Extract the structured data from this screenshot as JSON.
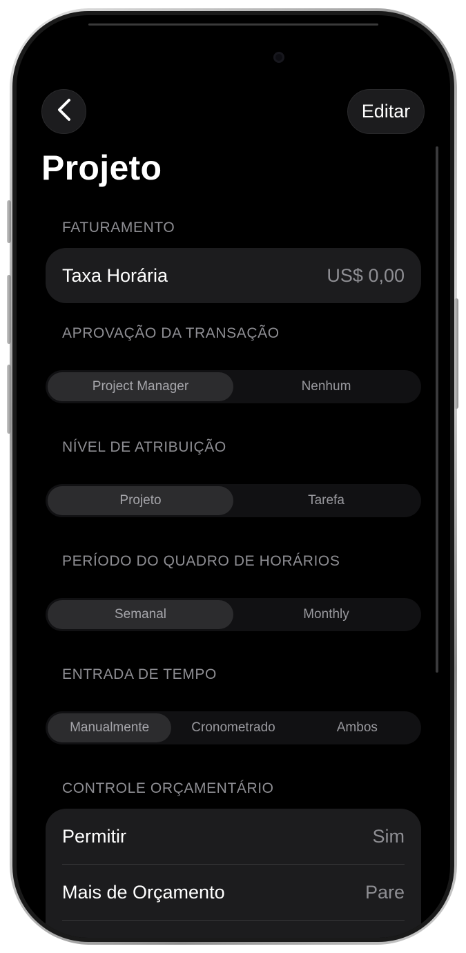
{
  "nav": {
    "back_icon": "chevron-left-icon",
    "edit_label": "Editar"
  },
  "title": "Projeto",
  "sections": {
    "faturamento": {
      "label": "FATURAMENTO",
      "row_label": "Taxa Horária",
      "row_value": "US$ 0,00"
    },
    "aprovacao": {
      "label": "APROVAÇÃO DA TRANSAÇÃO",
      "options": [
        "Project Manager",
        "Nenhum"
      ],
      "selected": "Project Manager"
    },
    "nivel": {
      "label": "NÍVEL DE ATRIBUIÇÃO",
      "options": [
        "Projeto",
        "Tarefa"
      ],
      "selected": "Projeto"
    },
    "periodo": {
      "label": "PERÍODO DO QUADRO DE HORÁRIOS",
      "options": [
        "Semanal",
        "Monthly"
      ],
      "selected": "Semanal"
    },
    "entrada": {
      "label": "ENTRADA DE TEMPO",
      "options": [
        "Manualmente",
        "Cronometrado",
        "Ambos"
      ],
      "selected": "Manualmente"
    },
    "controle": {
      "label": "CONTROLE ORÇAMENTÁRIO",
      "rows": [
        {
          "label": "Permitir",
          "value": "Sim"
        },
        {
          "label": "Mais de Orçamento",
          "value": "Pare"
        }
      ]
    }
  },
  "colors": {
    "background": "#000000",
    "card": "#1c1c1e",
    "secondary_text": "#8e8e93"
  }
}
